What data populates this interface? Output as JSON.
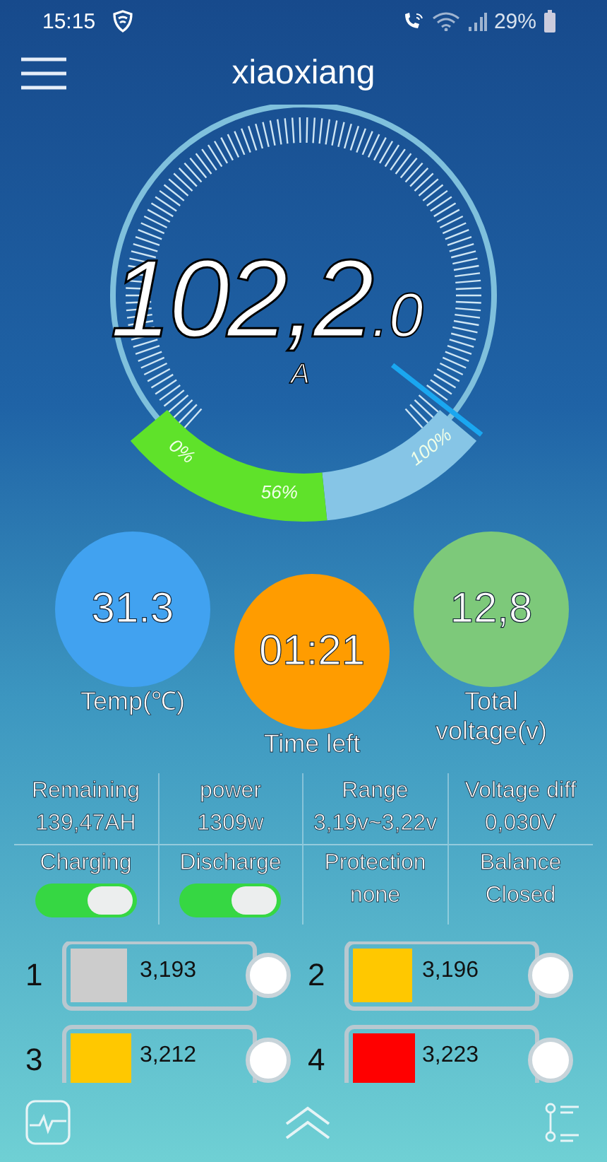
{
  "status_bar": {
    "time": "15:15",
    "battery": "29%"
  },
  "header": {
    "title": "xiaoxiang"
  },
  "gauge": {
    "value": "102,2",
    "decimal": ".0",
    "unit": "A"
  },
  "charge_bar": {
    "labels": [
      "0%",
      "56%",
      "100%"
    ]
  },
  "circles": [
    {
      "value": "31.3",
      "label": "Temp(℃)",
      "color": "#41a2f0"
    },
    {
      "value": "01:21",
      "label": "Time left",
      "color": "#ff9c00"
    },
    {
      "value": "12,8",
      "label": "Total voltage(v)",
      "color": "#7dc97a"
    }
  ],
  "stats": [
    {
      "kind": "value",
      "label": "Remaining",
      "value": "139,47AH"
    },
    {
      "kind": "value",
      "label": "power",
      "value": "1309w"
    },
    {
      "kind": "value",
      "label": "Range",
      "value": "3,19v~3,22v"
    },
    {
      "kind": "value",
      "label": "Voltage diff",
      "value": "0,030V"
    },
    {
      "kind": "toggle",
      "label": "Charging",
      "on": true
    },
    {
      "kind": "toggle",
      "label": "Discharge",
      "on": true
    },
    {
      "kind": "value",
      "label": "Protection",
      "value": "none"
    },
    {
      "kind": "value",
      "label": "Balance",
      "value": "Closed"
    }
  ],
  "cells": [
    {
      "number": "1",
      "value": "3,193",
      "level": 0.32,
      "color": "#cccccc",
      "checked": false
    },
    {
      "number": "2",
      "value": "3,196",
      "level": 0.33,
      "color": "#ffc800",
      "checked": false
    },
    {
      "number": "3",
      "value": "3,212",
      "level": 0.34,
      "color": "#ffc800",
      "checked": false
    },
    {
      "number": "4",
      "value": "3,223",
      "level": 0.35,
      "color": "#ff0000",
      "checked": false
    }
  ]
}
